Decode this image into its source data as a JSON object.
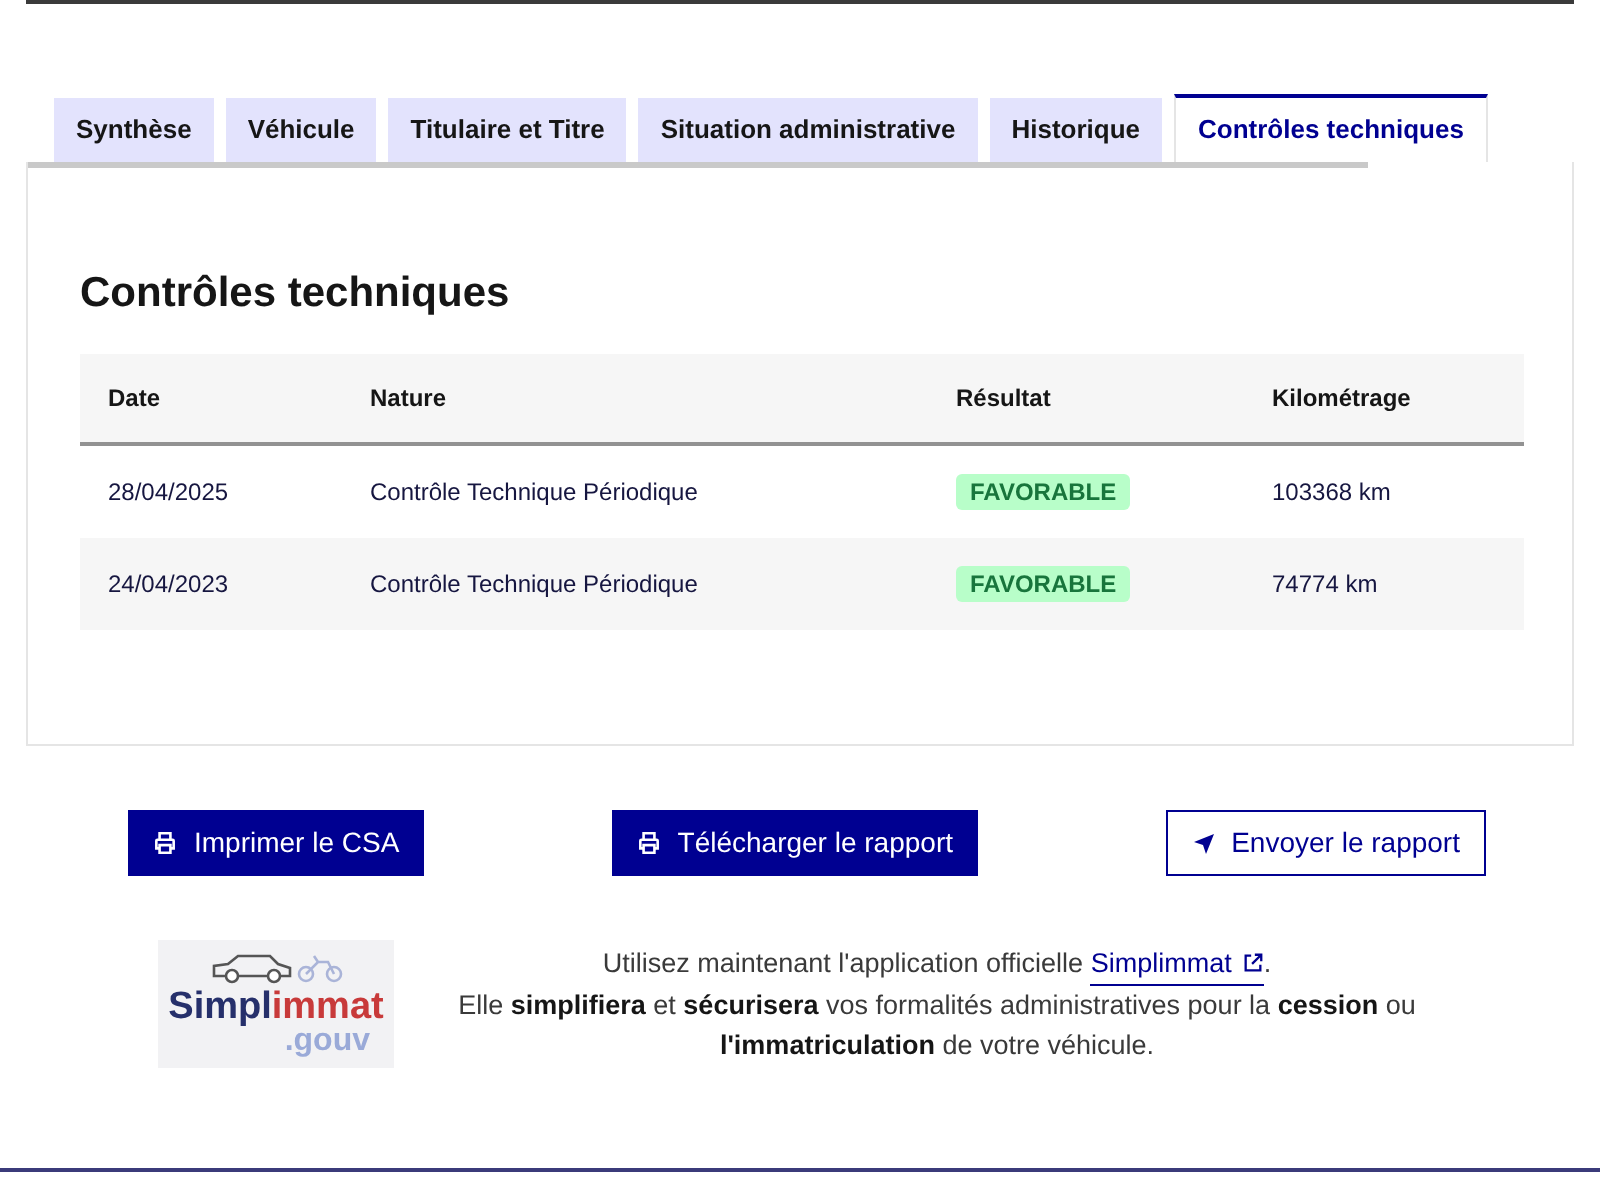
{
  "tabs": [
    {
      "label": "Synthèse",
      "selected": false
    },
    {
      "label": "Véhicule",
      "selected": false
    },
    {
      "label": "Titulaire et Titre",
      "selected": false
    },
    {
      "label": "Situation administrative",
      "selected": false
    },
    {
      "label": "Historique",
      "selected": false
    },
    {
      "label": "Contrôles techniques",
      "selected": true
    }
  ],
  "panel": {
    "title": "Contrôles techniques",
    "table": {
      "columns": [
        "Date",
        "Nature",
        "Résultat",
        "Kilométrage"
      ],
      "rows": [
        {
          "date": "28/04/2025",
          "nature": "Contrôle Technique Périodique",
          "result": "FAVORABLE",
          "mileage": "103368 km"
        },
        {
          "date": "24/04/2023",
          "nature": "Contrôle Technique Périodique",
          "result": "FAVORABLE",
          "mileage": "74774 km"
        }
      ]
    }
  },
  "actions": [
    {
      "label": "Imprimer le CSA",
      "kind": "print",
      "primary": true
    },
    {
      "label": "Télécharger le rapport",
      "kind": "print",
      "primary": true
    },
    {
      "label": "Envoyer le rapport",
      "kind": "send",
      "primary": false
    }
  ],
  "promo": {
    "logo": {
      "word_1": "Simpl",
      "word_2": "immat",
      "suffix": ".gouv"
    },
    "line_1": "Utilisez maintenant l'application officielle",
    "link": "Simplimmat",
    "line_1_end": ".",
    "line_2": "Elle **simplifiera** et **sécurisera** vos formalités administratives pour la **cession** ou **l'immatriculation** de votre véhicule."
  }
}
